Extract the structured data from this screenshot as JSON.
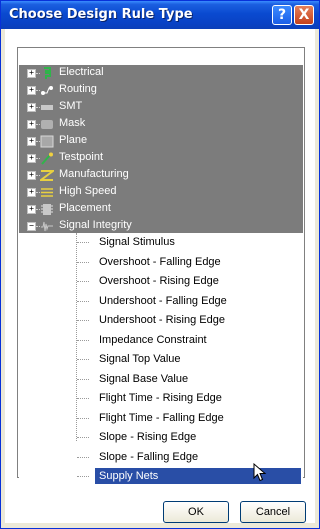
{
  "window": {
    "title": "Choose Design Rule Type"
  },
  "tree": {
    "categories": [
      {
        "label": "Electrical",
        "icon": "electrical-icon",
        "expander": "+"
      },
      {
        "label": "Routing",
        "icon": "routing-icon",
        "expander": "+"
      },
      {
        "label": "SMT",
        "icon": "smt-icon",
        "expander": "+"
      },
      {
        "label": "Mask",
        "icon": "mask-icon",
        "expander": "+"
      },
      {
        "label": "Plane",
        "icon": "plane-icon",
        "expander": "+"
      },
      {
        "label": "Testpoint",
        "icon": "testpoint-icon",
        "expander": "+"
      },
      {
        "label": "Manufacturing",
        "icon": "manufacturing-icon",
        "expander": "+"
      },
      {
        "label": "High Speed",
        "icon": "high-speed-icon",
        "expander": "+"
      },
      {
        "label": "Placement",
        "icon": "placement-icon",
        "expander": "+"
      },
      {
        "label": "Signal Integrity",
        "icon": "signal-integrity-icon",
        "expander": "−"
      }
    ],
    "signal_integrity_children": [
      "Signal Stimulus",
      "Overshoot - Falling Edge",
      "Overshoot - Rising Edge",
      "Undershoot - Falling Edge",
      "Undershoot - Rising Edge",
      "Impedance Constraint",
      "Signal Top Value",
      "Signal Base Value",
      "Flight Time - Rising Edge",
      "Flight Time - Falling Edge",
      "Slope - Rising Edge",
      "Slope - Falling Edge",
      "Supply Nets"
    ],
    "selected": "Supply Nets"
  },
  "buttons": {
    "ok": "OK",
    "cancel": "Cancel",
    "help": "?",
    "close": "X"
  },
  "colors": {
    "titlebar": "#0a4ad0",
    "category_bg": "#7c7c7c",
    "selection": "#294ea6"
  }
}
